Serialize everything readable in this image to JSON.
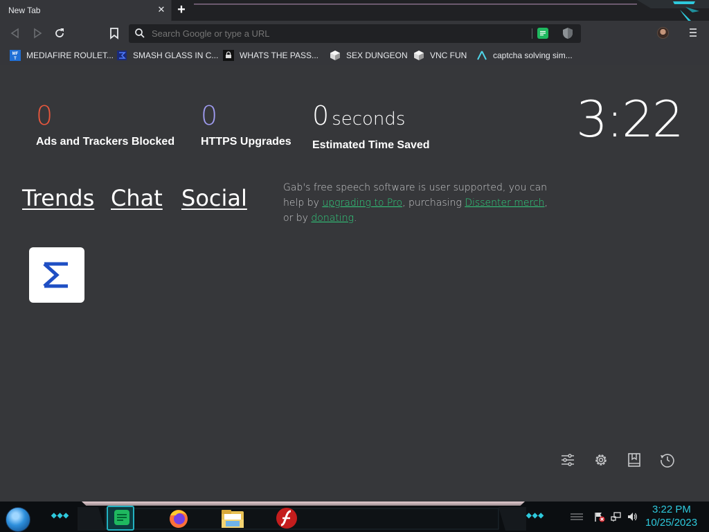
{
  "tab": {
    "title": "New Tab",
    "close_glyph": "✕",
    "new_tab_glyph": "+"
  },
  "omnibox": {
    "placeholder": "Search Google or type a URL"
  },
  "bookmarks": [
    {
      "label": "MEDIAFIRE ROULET...",
      "icon": "mediafire-icon"
    },
    {
      "label": "SMASH GLASS IN C...",
      "icon": "smash-glass-icon"
    },
    {
      "label": "WHATS THE PASS...",
      "icon": "lock-site-icon"
    },
    {
      "label": "SEX DUNGEON",
      "icon": "cube-icon"
    },
    {
      "label": "VNC FUN",
      "icon": "cube-icon"
    },
    {
      "label": "captcha solving sim...",
      "icon": "triangle-a-icon"
    }
  ],
  "stats": {
    "ads_blocked": {
      "value": "0",
      "label": "Ads and Trackers Blocked",
      "color": "#e8573d"
    },
    "https_upgrades": {
      "value": "0",
      "label": "HTTPS Upgrades",
      "color": "#a09cf2"
    },
    "time_saved": {
      "value": "0",
      "unit": "seconds",
      "label": "Estimated Time Saved",
      "color": "#ffffff"
    }
  },
  "clock": "3:22",
  "nav_links": [
    "Trends",
    "Chat",
    "Social"
  ],
  "gab_message": {
    "part1": "Gab's free speech software is user supported, you can help by ",
    "link1": "upgrading to Pro",
    "part2": ", purchasing ",
    "link2": "Dissenter merch",
    "part3": ", or by ",
    "link3": "donating",
    "part4": "."
  },
  "taskbar": {
    "time": "3:22 PM",
    "date": "10/25/2023"
  },
  "colors": {
    "accent_green": "#30ce7d",
    "taskbar_cyan": "#2ec9dc"
  }
}
